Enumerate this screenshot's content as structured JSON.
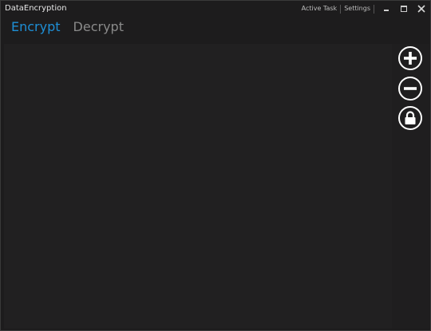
{
  "window": {
    "title": "DataEncryption"
  },
  "title_commands": [
    {
      "label": "Active Task"
    },
    {
      "label": "Settings"
    }
  ],
  "tabs": [
    {
      "label": "Encrypt",
      "active": true
    },
    {
      "label": "Decrypt",
      "active": false
    }
  ],
  "side_buttons": [
    {
      "icon": "plus-icon"
    },
    {
      "icon": "minus-icon"
    },
    {
      "icon": "lock-icon"
    }
  ],
  "colors": {
    "accent": "#1e8fd6",
    "background": "#1d1c1d",
    "panel": "#212021",
    "inactive_tab": "#8a8a8a"
  }
}
